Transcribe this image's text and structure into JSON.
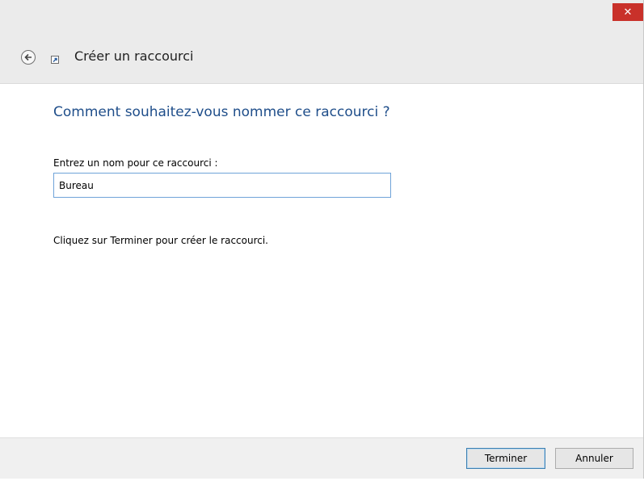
{
  "window": {
    "close_label": "✕"
  },
  "header": {
    "title": "Créer un raccourci"
  },
  "main": {
    "question": "Comment souhaitez-vous nommer ce raccourci ?",
    "field_label": "Entrez un nom pour ce raccourci :",
    "name_value": "Bureau",
    "info": "Cliquez sur Terminer pour créer le raccourci."
  },
  "footer": {
    "finish_label": "Terminer",
    "cancel_label": "Annuler"
  },
  "colors": {
    "close": "#c9312a",
    "heading": "#1f4e8a",
    "input_border": "#6fa3d9"
  },
  "icons": {
    "back": "back-arrow-icon",
    "shortcut": "shortcut-wizard-icon",
    "close": "close-icon"
  }
}
